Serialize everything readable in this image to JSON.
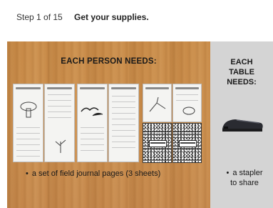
{
  "header": {
    "step_counter": "Step 1 of 15",
    "step_title": "Get your supplies."
  },
  "person_panel": {
    "heading": "EACH PERSON NEEDS:",
    "bullet": "a set of field journal pages (3 sheets)"
  },
  "table_panel": {
    "heading_line1": "EACH",
    "heading_line2": "TABLE",
    "heading_line3": "NEEDS:",
    "bullet_line1": "a stapler",
    "bullet_line2": "to share"
  },
  "icons": [
    "stapler-icon",
    "field-journal-sheet-icon",
    "composition-notebook-icon"
  ],
  "colors": {
    "wood": "#c98c4b",
    "gray_panel": "#d4d4d4",
    "header_bg": "#ffffff"
  }
}
